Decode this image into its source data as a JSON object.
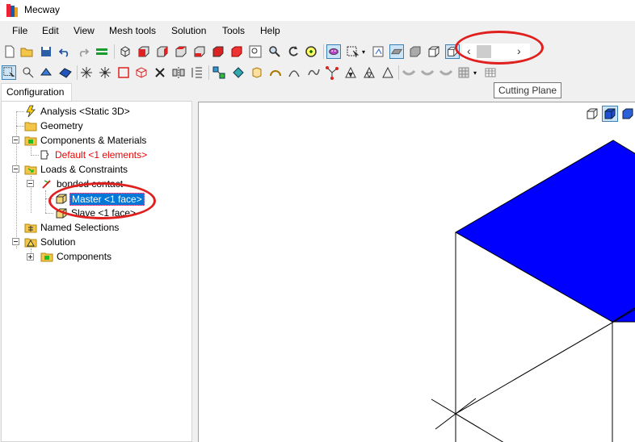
{
  "app": {
    "title": "Mecway",
    "icon_name": "mecway-app-icon"
  },
  "menu": {
    "items": [
      "File",
      "Edit",
      "View",
      "Mesh tools",
      "Solution",
      "Tools",
      "Help"
    ]
  },
  "toolbar": {
    "scroll_left_glyph": "‹",
    "scroll_right_glyph": "›",
    "tooltip": "Cutting Plane"
  },
  "tabs": {
    "configuration": "Configuration"
  },
  "tree": {
    "analysis": "Analysis <Static 3D>",
    "geometry": "Geometry",
    "components_materials": "Components & Materials",
    "default_component": "Default <1 elements>",
    "loads_constraints": "Loads & Constraints",
    "bonded_contact": "bonded contact",
    "master": "Master <1 face>",
    "slave": "Slave <1 face>",
    "named_selections": "Named Selections",
    "solution": "Solution",
    "components": "Components"
  },
  "colors": {
    "selection": "#0078d7",
    "error_text": "#ee0000",
    "face_fill": "#0000ff",
    "annotation": "#e0201e"
  }
}
